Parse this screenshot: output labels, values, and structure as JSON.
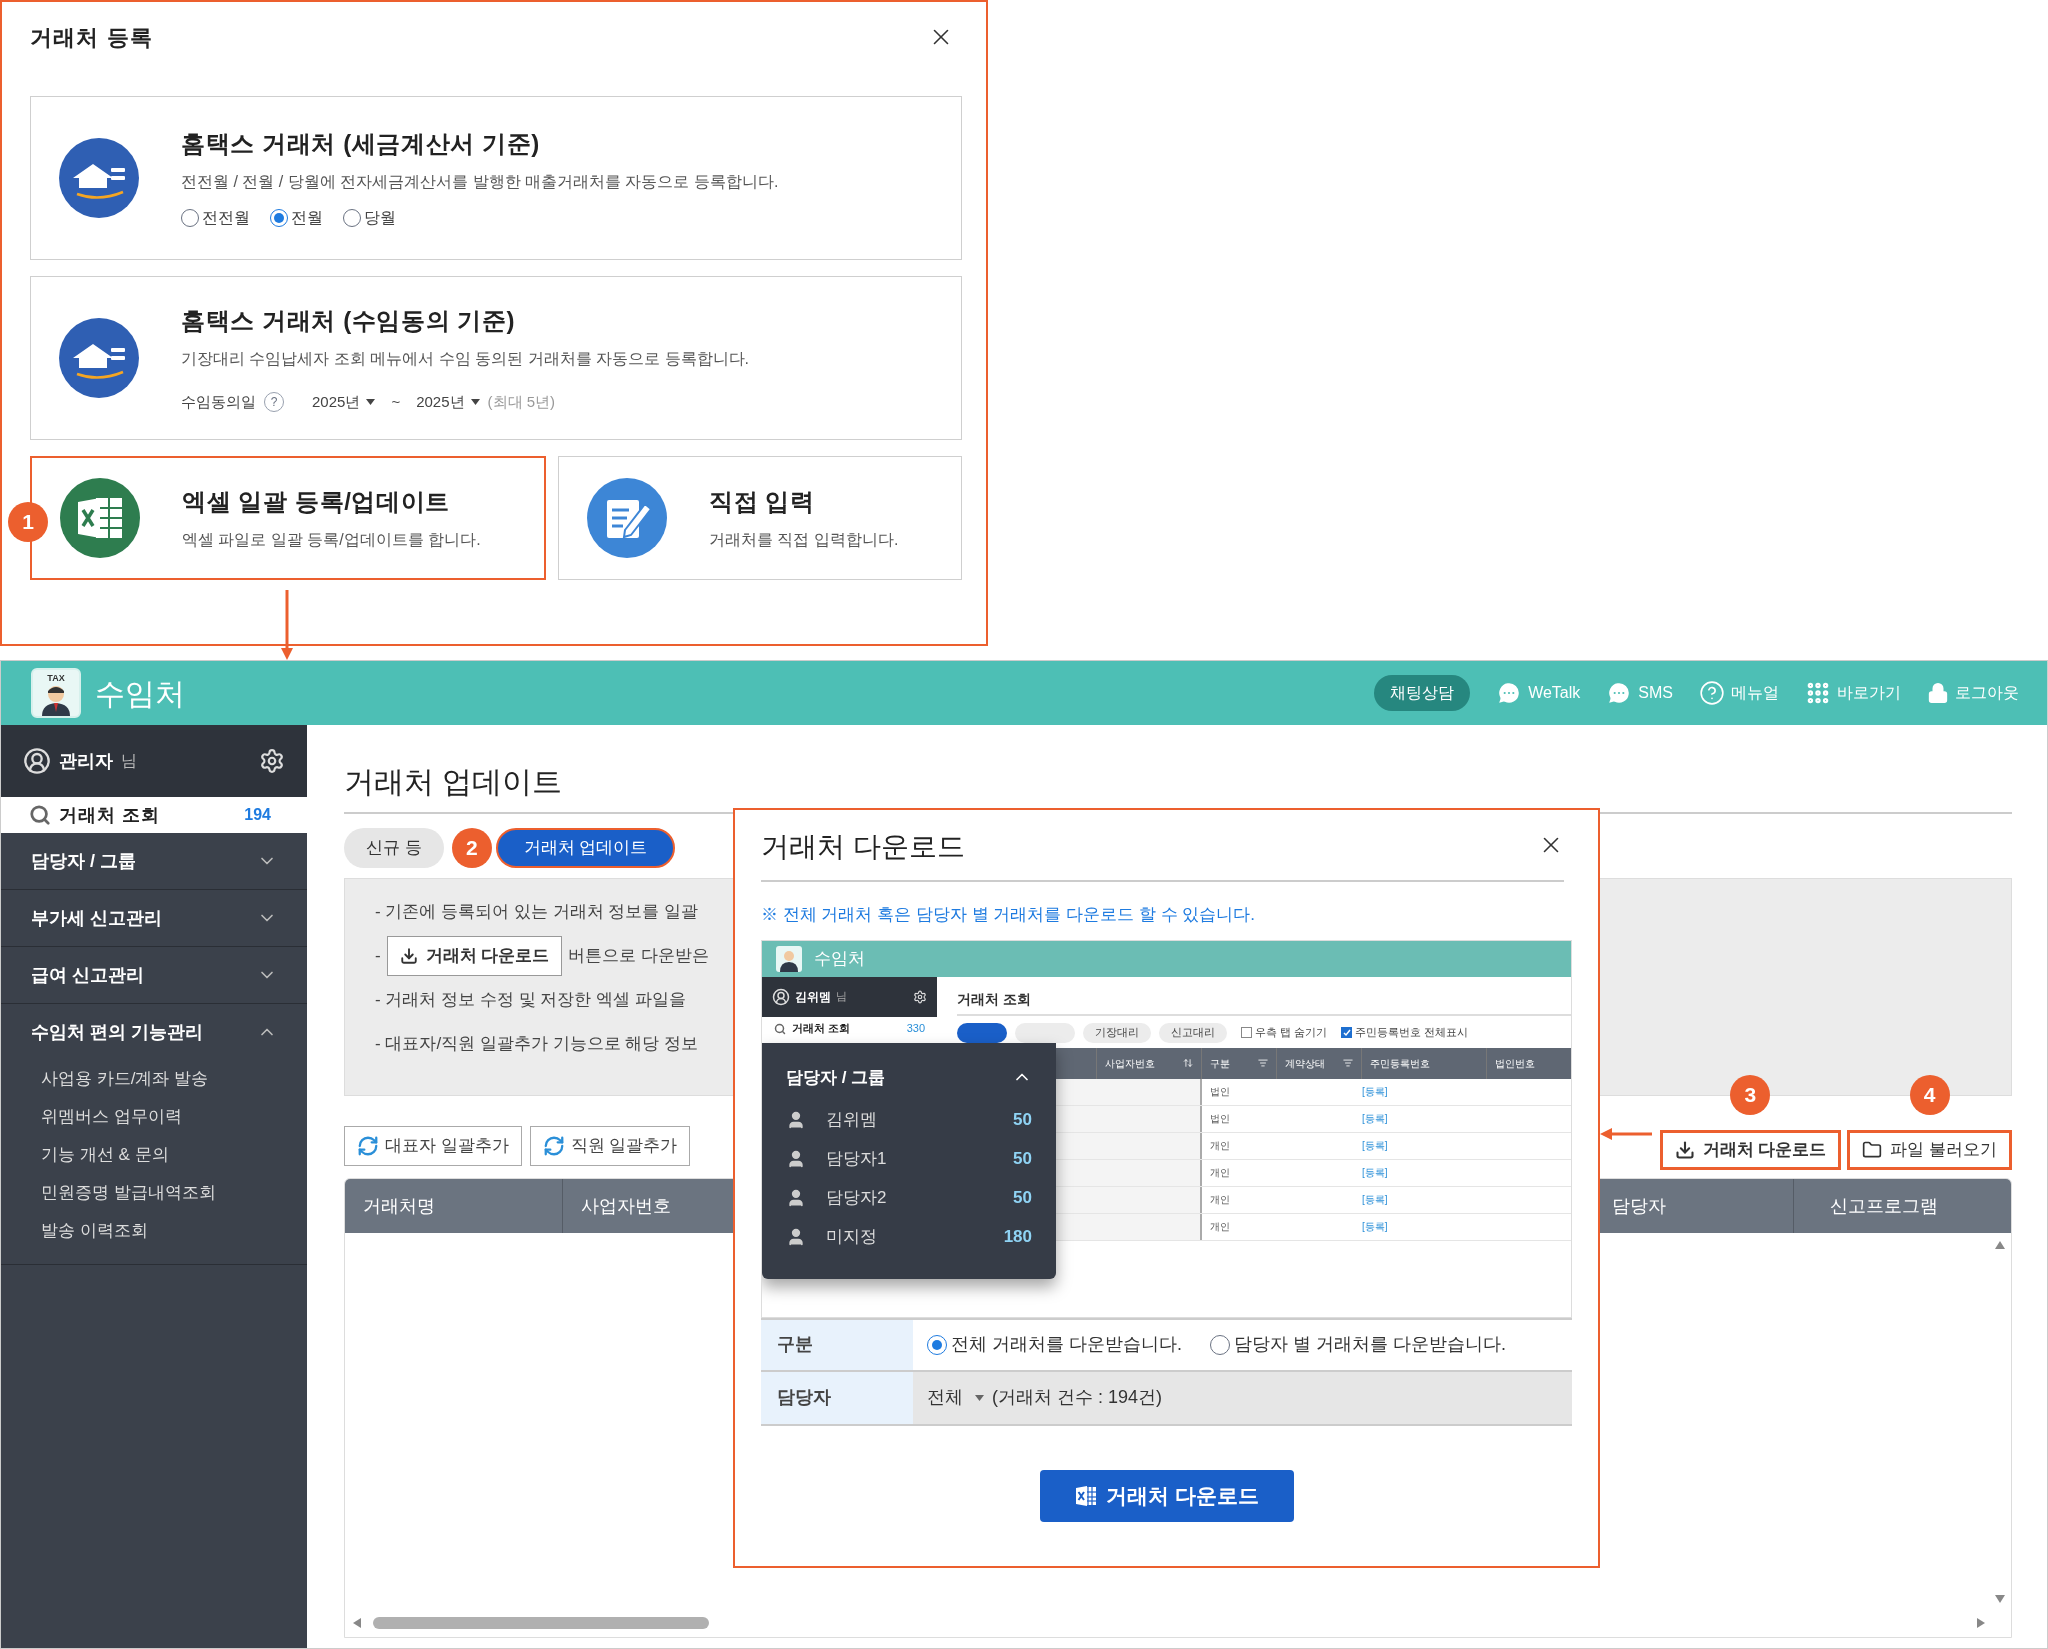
{
  "register_dialog": {
    "title": "거래처 등록",
    "options": [
      {
        "kind": "hometax",
        "title": "홈택스 거래처 (세금계산서 기준)",
        "description": "전전월 / 전월 / 당월에 전자세금계산서를 발행한 매출거래처를 자동으로 등록합니다.",
        "highlighted": false,
        "radios": [
          {
            "label": "전전월",
            "selected": false
          },
          {
            "label": "전월",
            "selected": true
          },
          {
            "label": "당월",
            "selected": false
          }
        ]
      },
      {
        "kind": "hometax",
        "title": "홈택스 거래처 (수임동의 기준)",
        "description": "기장대리 수임납세자 조회 메뉴에서 수임 동의된 거래처를 자동으로 등록합니다.",
        "highlighted": false,
        "date_range": {
          "label": "수임동의일",
          "help": "?",
          "from": "2025년",
          "separator": "~",
          "to": "2025년",
          "note": "(최대 5년)"
        }
      },
      {
        "kind": "excel",
        "title": "엑셀 일괄 등록/업데이트",
        "description": "엑셀 파일로 일괄 등록/업데이트를 합니다.",
        "highlighted": true,
        "step": "1"
      },
      {
        "kind": "manual",
        "title": "직접 입력",
        "description": "거래처를 직접 입력합니다.",
        "highlighted": false
      }
    ]
  },
  "app": {
    "logo_text": "TAX",
    "title": "수임처",
    "header_actions": [
      {
        "kind": "pill",
        "label": "채팅상담"
      },
      {
        "kind": "chat",
        "label": "WeTalk"
      },
      {
        "kind": "chat",
        "label": "SMS"
      },
      {
        "kind": "help",
        "label": "메뉴얼"
      },
      {
        "kind": "grid",
        "label": "바로가기"
      },
      {
        "kind": "lock",
        "label": "로그아웃"
      }
    ]
  },
  "sidebar": {
    "user": "관리자",
    "user_suffix": "님",
    "search_item": {
      "label": "거래처 조회",
      "count": "194"
    },
    "sections": [
      {
        "label": "담당자 / 그룹",
        "expanded": false
      },
      {
        "label": "부가세 신고관리",
        "expanded": false
      },
      {
        "label": "급여 신고관리",
        "expanded": false
      },
      {
        "label": "수임처 편의 기능관리",
        "expanded": true,
        "children": [
          {
            "label": "사업용 카드/계좌 발송"
          },
          {
            "label": "위멤버스 업무이력"
          },
          {
            "label": "기능 개선 & 문의"
          },
          {
            "label": "민원증명 발급내역조회"
          },
          {
            "label": "발송 이력조회"
          }
        ]
      }
    ]
  },
  "page": {
    "title": "거래처 업데이트",
    "tabs": [
      {
        "label": "신규 등",
        "selected": false
      },
      {
        "label": "거래처 업데이트",
        "selected": true,
        "step": "2"
      }
    ],
    "info_lines": [
      {
        "kind": "text",
        "text": "- 기존에 등록되어 있는 거래처 정보를 일괄"
      },
      {
        "kind": "button",
        "prefix": "-",
        "button": "거래처 다운로드",
        "suffix": "버튼으로 다운받은"
      },
      {
        "kind": "text",
        "text": "- 거래처 정보 수정 및 저장한 엑셀 파일을"
      },
      {
        "kind": "text",
        "text": "- 대표자/직원 일괄추가 기능으로 해당 정보"
      }
    ],
    "bulk_buttons": [
      {
        "label": "대표자 일괄추가"
      },
      {
        "label": "직원 일괄추가"
      }
    ],
    "actions": [
      {
        "kind": "download",
        "label": "거래처 다운로드",
        "step": "3",
        "highlighted": true
      },
      {
        "kind": "folder",
        "label": "파일 불러오기",
        "step": "4",
        "highlighted": true
      }
    ],
    "table": {
      "columns_left": [
        "거래처명",
        "사업자번호"
      ],
      "columns_right": [
        "담당자",
        "신고프로그램"
      ]
    }
  },
  "download_modal": {
    "title": "거래처 다운로드",
    "notice": "※ 전체 거래처 혹은 담당자 별 거래처를 다운로드 할 수 있습니다.",
    "preview": {
      "app_title": "수임처",
      "user": "김위멤",
      "user_suffix": "님",
      "menu_item": {
        "label": "거래처 조회",
        "count": "330"
      },
      "page_title": "거래처 조회",
      "tabs": [
        {
          "label": "기장대리"
        },
        {
          "label": "신고대리"
        }
      ],
      "checkboxes": [
        {
          "label": "우측 탭 숨기기",
          "checked": false
        },
        {
          "label": "주민등록번호 전체표시",
          "checked": true
        }
      ],
      "columns": [
        "사업자번호",
        "구분",
        "계약상태",
        "주민등록번호",
        "법인번호"
      ],
      "rows": [
        {
          "type": "법인",
          "link": "[등록]"
        },
        {
          "type": "법인",
          "link": "[등록]"
        },
        {
          "type": "개인",
          "link": "[등록]"
        },
        {
          "type": "개인",
          "link": "[등록]"
        },
        {
          "type": "개인",
          "link": "[등록]"
        },
        {
          "type": "개인",
          "link": "[등록]"
        }
      ],
      "dropdown": {
        "title": "담당자 / 그룹",
        "expanded": true,
        "items": [
          {
            "name": "김위멤",
            "count": "50"
          },
          {
            "name": "담당자1",
            "count": "50"
          },
          {
            "name": "담당자2",
            "count": "50"
          },
          {
            "name": "미지정",
            "count": "180"
          }
        ]
      }
    },
    "form": {
      "scope_label": "구분",
      "scope_options": [
        {
          "label": "전체 거래처를 다운받습니다.",
          "selected": true
        },
        {
          "label": "담당자 별 거래처를 다운받습니다.",
          "selected": false
        }
      ],
      "manager_label": "담당자",
      "manager_value": "전체",
      "manager_note": "(거래처 건수 : 194건)"
    },
    "submit": "거래처 다운로드"
  }
}
